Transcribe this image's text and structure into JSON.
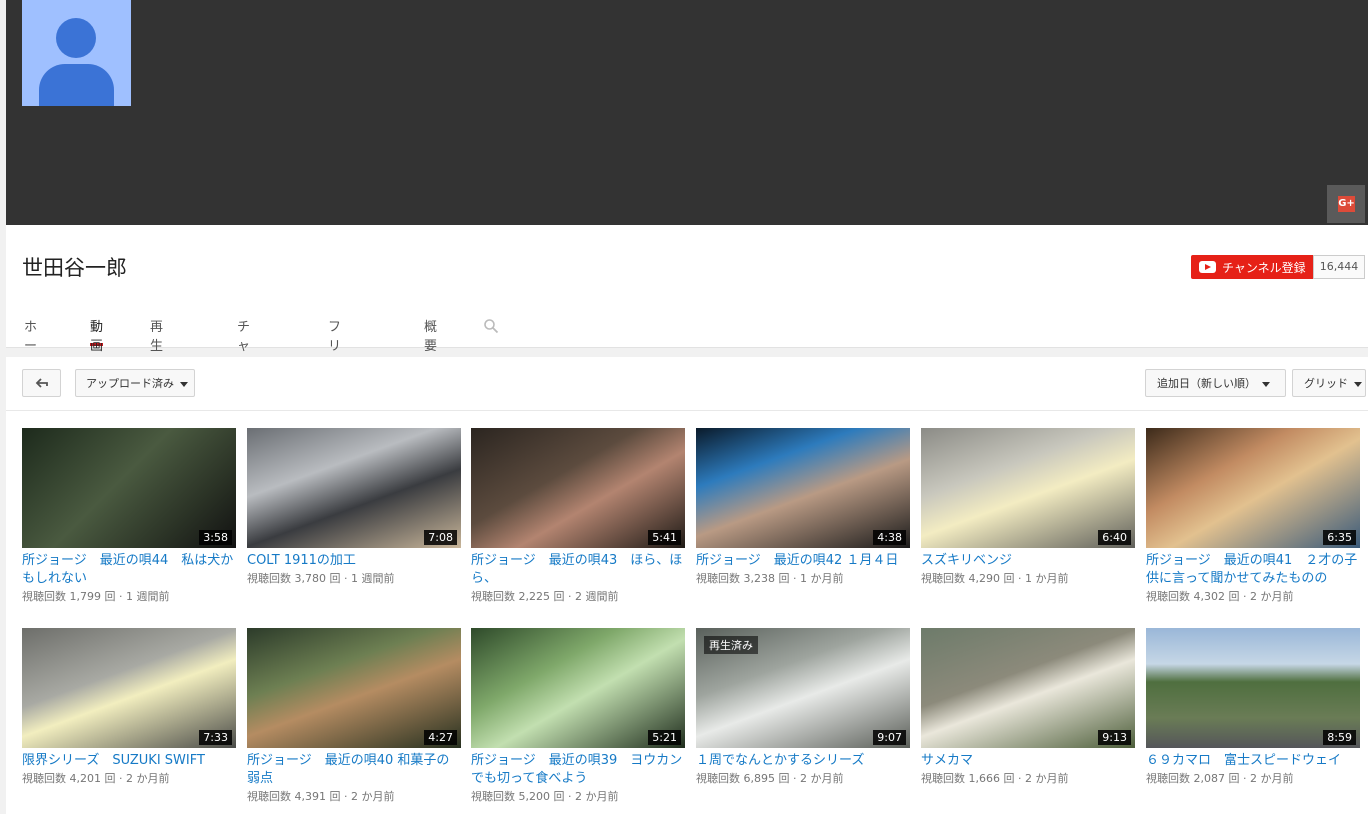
{
  "channel": {
    "name": "世田谷一郎"
  },
  "subscribe": {
    "label": "チャンネル登録",
    "count": "16,444"
  },
  "tabs": [
    "ホーム",
    "動画",
    "再生リスト",
    "チャンネル",
    "フリートーク",
    "概要"
  ],
  "toolbar": {
    "uploads_label": "アップロード済み",
    "sort_label": "追加日（新しい順）",
    "view_label": "グリッド"
  },
  "colors": {
    "accent": "#cc181e",
    "link": "#167ac6",
    "banner": "#333333"
  },
  "videos": [
    {
      "title": "所ジョージ　最近の唄44　私は犬かもしれない",
      "views": "視聴回数 1,799 回",
      "age": "1 週間前",
      "duration": "3:58",
      "watched": ""
    },
    {
      "title": "COLT 1911の加工",
      "views": "視聴回数 3,780 回",
      "age": "1 週間前",
      "duration": "7:08",
      "watched": ""
    },
    {
      "title": "所ジョージ　最近の唄43　ほら、ほら、",
      "views": "視聴回数 2,225 回",
      "age": "2 週間前",
      "duration": "5:41",
      "watched": ""
    },
    {
      "title": "所ジョージ　最近の唄42 １月４日",
      "views": "視聴回数 3,238 回",
      "age": "1 か月前",
      "duration": "4:38",
      "watched": ""
    },
    {
      "title": "スズキリベンジ",
      "views": "視聴回数 4,290 回",
      "age": "1 か月前",
      "duration": "6:40",
      "watched": ""
    },
    {
      "title": "所ジョージ　最近の唄41　２才の子供に言って聞かせてみたものの",
      "views": "視聴回数 4,302 回",
      "age": "2 か月前",
      "duration": "6:35",
      "watched": ""
    },
    {
      "title": "限界シリーズ　SUZUKI SWIFT",
      "views": "視聴回数 4,201 回",
      "age": "2 か月前",
      "duration": "7:33",
      "watched": ""
    },
    {
      "title": "所ジョージ　最近の唄40 和菓子の弱点",
      "views": "視聴回数 4,391 回",
      "age": "2 か月前",
      "duration": "4:27",
      "watched": ""
    },
    {
      "title": "所ジョージ　最近の唄39　ヨウカンでも切って食べよう",
      "views": "視聴回数 5,200 回",
      "age": "2 か月前",
      "duration": "5:21",
      "watched": ""
    },
    {
      "title": "１周でなんとかするシリーズ",
      "views": "視聴回数 6,895 回",
      "age": "2 か月前",
      "duration": "9:07",
      "watched": "再生済み"
    },
    {
      "title": "サメカマ",
      "views": "視聴回数 1,666 回",
      "age": "2 か月前",
      "duration": "9:13",
      "watched": ""
    },
    {
      "title": "６９カマロ　富士スピードウェイ",
      "views": "視聴回数 2,087 回",
      "age": "2 か月前",
      "duration": "8:59",
      "watched": ""
    }
  ]
}
